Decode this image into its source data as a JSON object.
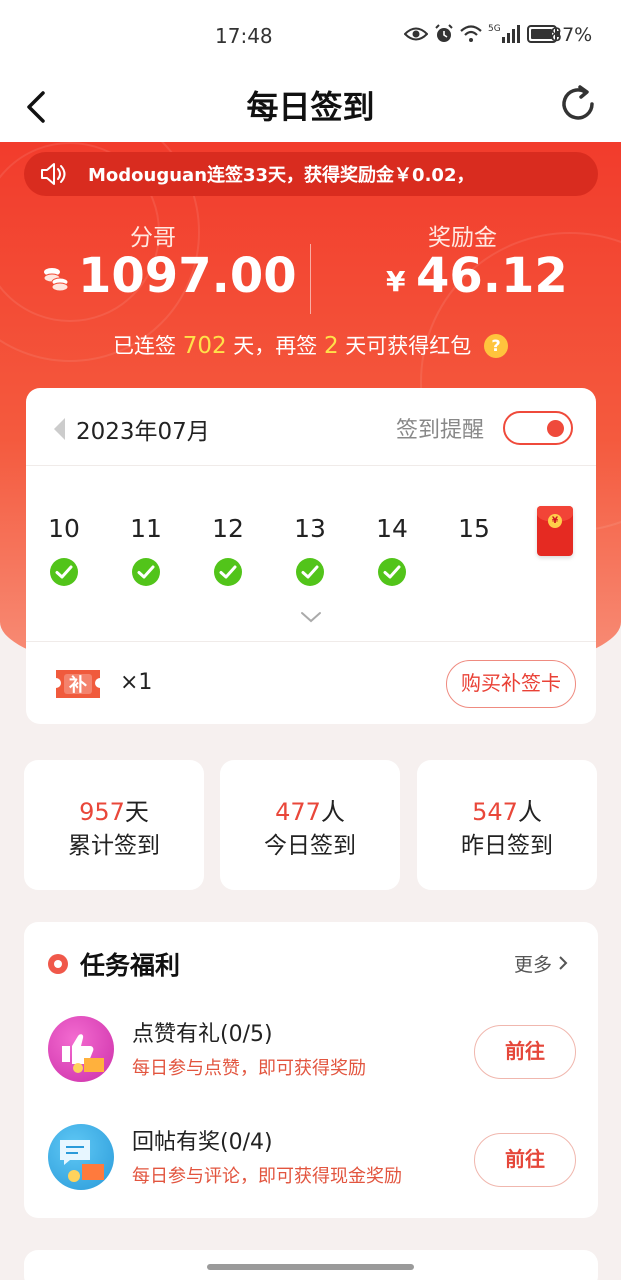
{
  "status_bar": {
    "time": "17:48",
    "network": "5G",
    "battery": "87%",
    "icons": [
      "eye-icon",
      "alarm-icon",
      "wifi-icon",
      "signal-icon",
      "battery-icon"
    ]
  },
  "header": {
    "title": "每日签到",
    "back_icon": "chevron-left-icon",
    "refresh_icon": "refresh-icon"
  },
  "ticker": {
    "text": "Modouguan连签33天，获得奖励金￥0.02，",
    "icon": "speaker-icon"
  },
  "stats": {
    "points_label": "分哥",
    "points_value": "1097.00",
    "reward_label": "奖励金",
    "reward_currency": "¥",
    "reward_value": "46.12"
  },
  "streak": {
    "prefix": "已连签",
    "days": "702",
    "middle": "天，再签",
    "remaining": "2",
    "suffix": "天可获得红包",
    "help": "?"
  },
  "calendar": {
    "month": "2023年07月",
    "reminder_label": "签到提醒",
    "reminder_on": true,
    "days": [
      {
        "day": "10",
        "signed": true
      },
      {
        "day": "11",
        "signed": true
      },
      {
        "day": "12",
        "signed": true
      },
      {
        "day": "13",
        "signed": true
      },
      {
        "day": "14",
        "signed": true
      },
      {
        "day": "15",
        "signed": false
      }
    ],
    "makeup_card_count": "×1",
    "makeup_card_glyph": "补",
    "buy_button": "购买补签卡"
  },
  "summary": [
    {
      "value": "957",
      "unit": "天",
      "label": "累计签到"
    },
    {
      "value": "477",
      "unit": "人",
      "label": "今日签到"
    },
    {
      "value": "547",
      "unit": "人",
      "label": "昨日签到"
    }
  ],
  "tasks": {
    "title": "任务福利",
    "more": "更多",
    "items": [
      {
        "name": "点赞有礼(0/5)",
        "desc": "每日参与点赞，即可获得奖励",
        "button": "前往",
        "icon": "thumbs-up-gift-icon"
      },
      {
        "name": "回帖有奖(0/4)",
        "desc": "每日参与评论，即可获得现金奖励",
        "button": "前往",
        "icon": "comment-gift-icon"
      }
    ]
  },
  "colors": {
    "brand_red": "#f23c2c",
    "highlight_yellow": "#ffe14a",
    "check_green": "#52c41a"
  }
}
